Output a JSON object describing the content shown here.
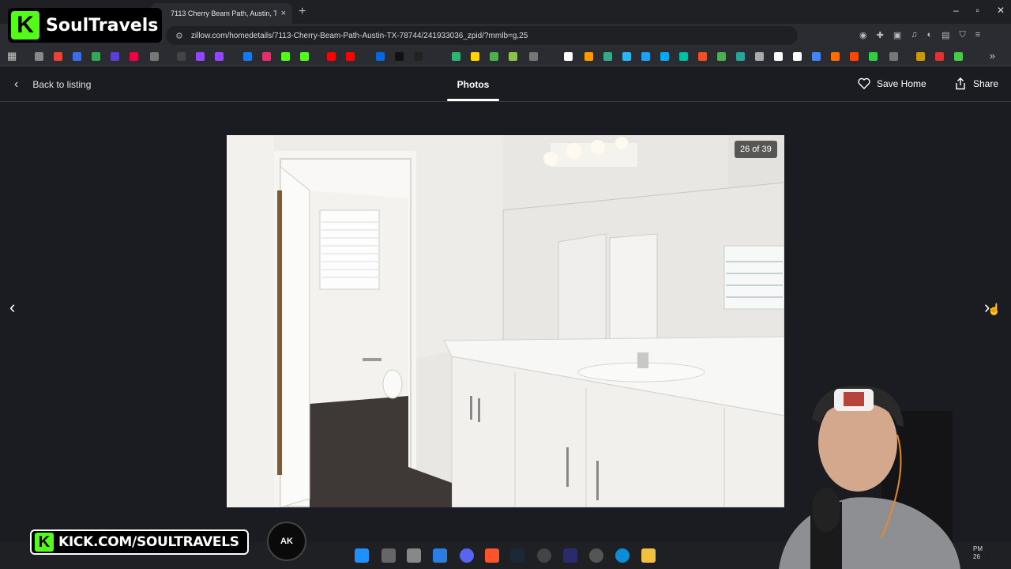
{
  "browser": {
    "tab_title": "7113 Cherry Beam Path, Austin, T",
    "tab_close": "×",
    "new_tab": "+",
    "url": "zillow.com/homedetails/7113-Cherry-Beam-Path-Austin-TX-78744/241933036_zpid/?mmlb=g,25",
    "window_controls": [
      "–",
      "▫",
      "✕"
    ]
  },
  "overlay": {
    "brand_name": "SoulTravels",
    "brand_letter": "K",
    "kick_url": "KICK.COM/SOULTRAVELS",
    "ak_badge": "AK"
  },
  "header": {
    "back_label": "Back to listing",
    "active_tab": "Photos",
    "save_label": "Save Home",
    "share_label": "Share"
  },
  "gallery": {
    "counter": "26 of 39",
    "current_index": 26,
    "total": 39
  },
  "taskbar": {
    "clock_line1": "PM",
    "clock_line2": "26"
  },
  "colors": {
    "background": "#1b1c21",
    "kick_green": "#53fc18"
  }
}
